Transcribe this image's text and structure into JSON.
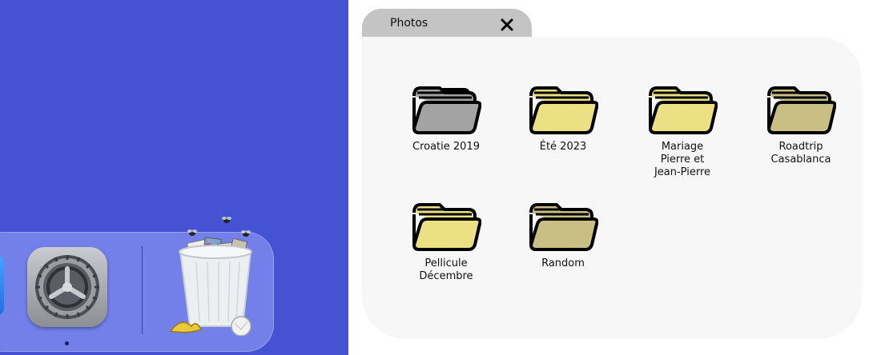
{
  "window": {
    "tab_title": "Photos"
  },
  "folders": [
    {
      "label": "Croatie 2019",
      "color": "#a3a3a3",
      "icon": "folder-icon"
    },
    {
      "label": "Été 2023",
      "color": "#ebe084",
      "icon": "folder-icon"
    },
    {
      "label": "Mariage\nPierre et\nJean-Pierre",
      "color": "#ebe084",
      "icon": "folder-icon"
    },
    {
      "label": "Roadtrip\nCasablanca",
      "color": "#c9bf85",
      "icon": "folder-icon"
    },
    {
      "label": "Pellicule\nDécembre",
      "color": "#ebe084",
      "icon": "folder-icon"
    },
    {
      "label": "Random",
      "color": "#c9bf85",
      "icon": "folder-icon"
    }
  ],
  "dock": {
    "items": [
      {
        "name": "system-settings",
        "icon": "gear-icon",
        "running": true
      },
      {
        "name": "trash",
        "icon": "trash-icon",
        "state": "full"
      }
    ]
  },
  "colors": {
    "wallpaper": "#4553d3",
    "dock": "#7380ea",
    "panel": "#f7f7f7",
    "tab": "#c4c4c4"
  }
}
